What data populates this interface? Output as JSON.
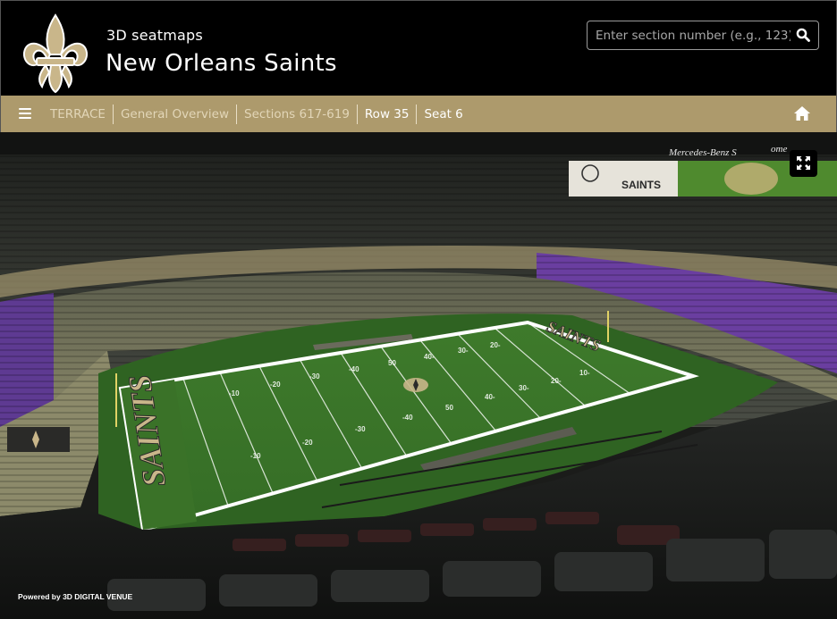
{
  "header": {
    "subtitle": "3D seatmaps",
    "title": "New Orleans Saints",
    "logo_icon": "fleur-de-lis-logo"
  },
  "search": {
    "placeholder": "Enter section number (e.g., 123)",
    "value": "",
    "icon": "search-icon"
  },
  "nav": {
    "menu_icon": "hamburger-menu-icon",
    "breadcrumbs": [
      {
        "label": "TERRACE"
      },
      {
        "label": "General Overview"
      },
      {
        "label": "Sections 617-619"
      },
      {
        "label": "Row 35"
      },
      {
        "label": "Seat 6"
      }
    ],
    "home_icon": "home-icon"
  },
  "view": {
    "fullscreen_icon": "fullscreen-icon",
    "scoreboard_text": "Mercedes-Benz S",
    "scoreboard_text_2": "ome",
    "banner_team": "SAINTS",
    "endzone_text": "SAINTS",
    "far_endzone_text": "SAINTS",
    "yard_numbers": [
      "-10",
      "-20",
      "-30",
      "-40",
      "50",
      "40-",
      "30-",
      "20-",
      "10-",
      "-10",
      "-20",
      "-30",
      "-40",
      "50",
      "40-",
      "30-",
      "20-"
    ],
    "powered_by": "Powered by 3D DIGITAL VENUE"
  },
  "colors": {
    "header_bg": "#000000",
    "nav_bg": "#ad9a6c",
    "field_green": "#3f7d2c",
    "seat_purple": "#6a3ea0",
    "seat_gold": "#9a9466"
  }
}
